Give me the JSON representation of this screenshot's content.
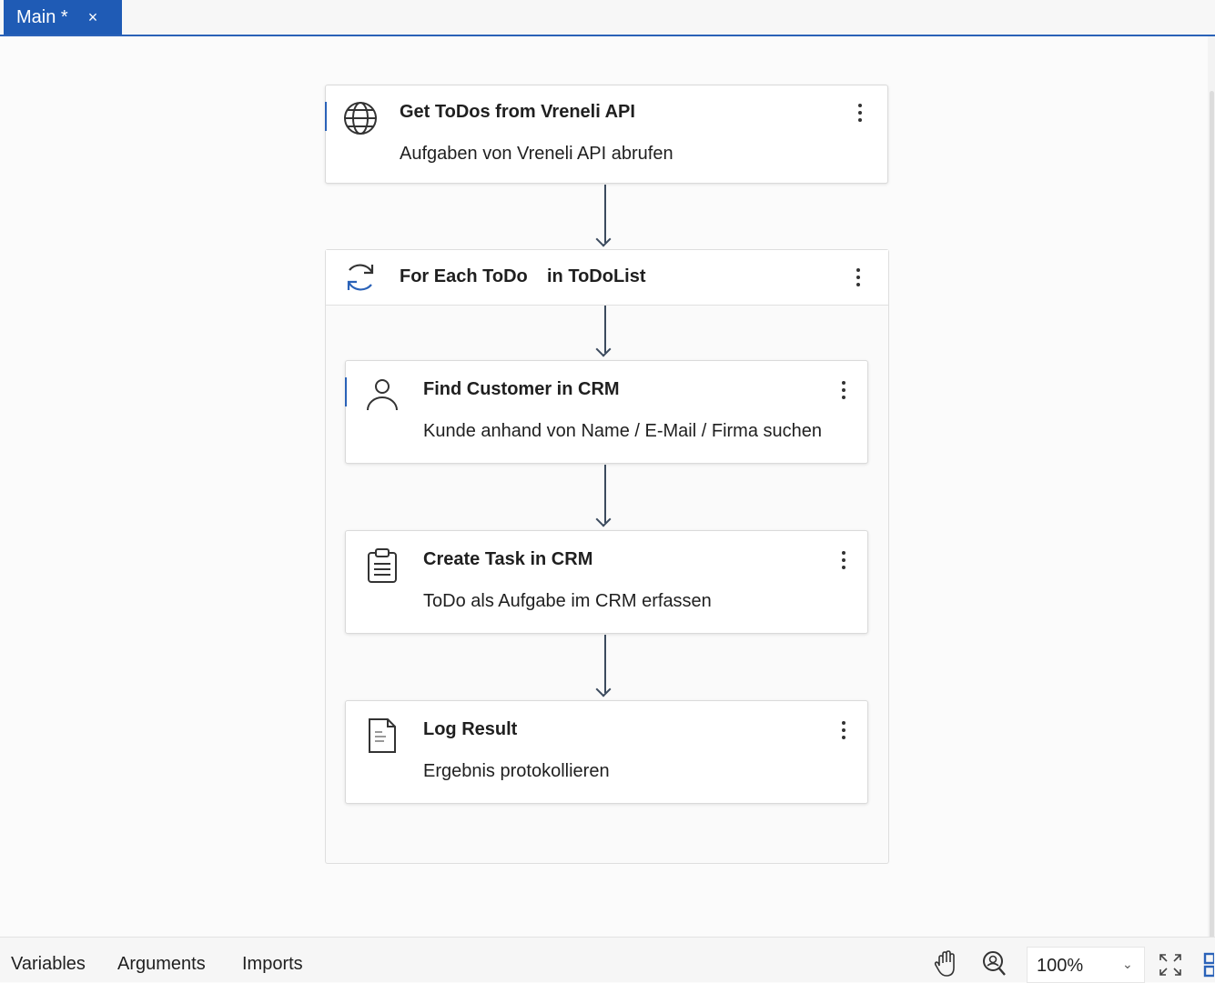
{
  "tab": {
    "label": "Main *",
    "close": "×"
  },
  "activities": {
    "get_todos": {
      "title": "Get ToDos from Vreneli API",
      "subtitle": "Aufgaben von Vreneli API abrufen",
      "icon": "globe-icon"
    },
    "foreach": {
      "title": "For Each ToDo",
      "in_text": "in ToDoList",
      "icon": "loop-icon"
    },
    "find_customer": {
      "title": "Find Customer in CRM",
      "subtitle": "Kunde anhand von Name / E-Mail / Firma suchen",
      "icon": "person-icon"
    },
    "create_task": {
      "title": "Create Task in CRM",
      "subtitle": "ToDo als Aufgabe im CRM erfassen",
      "icon": "clipboard-icon"
    },
    "log_result": {
      "title": "Log Result",
      "subtitle": "Ergebnis protokollieren",
      "icon": "document-icon"
    }
  },
  "bottom": {
    "variables": "Variables",
    "arguments": "Arguments",
    "imports": "Imports",
    "zoom": "100%",
    "zoom_caret": "⌄"
  },
  "colors": {
    "accent": "#1f5bb5",
    "arrow": "#3c4b5e"
  }
}
